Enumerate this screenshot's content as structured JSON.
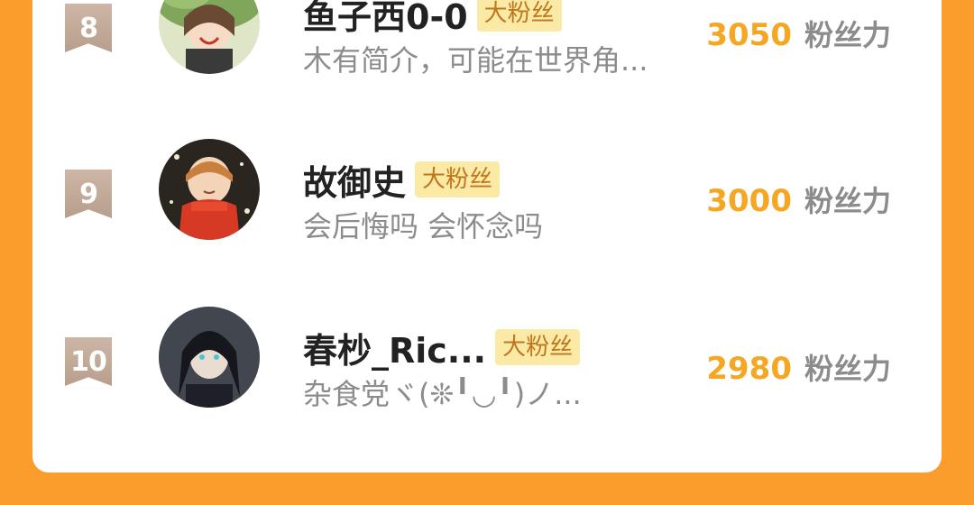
{
  "fans": [
    {
      "rank": "8",
      "name": "鱼子西0-0",
      "badge": "大粉丝",
      "bio": "木有简介，可能在世界角...",
      "score": "3050",
      "score_unit": "粉丝力"
    },
    {
      "rank": "9",
      "name": "故御史",
      "badge": "大粉丝",
      "bio": "会后悔吗 会怀念吗",
      "score": "3000",
      "score_unit": "粉丝力"
    },
    {
      "rank": "10",
      "name": "春杪_Ric...",
      "badge": "大粉丝",
      "bio": "杂食党ヾ(❊╹◡╹)ノ...",
      "score": "2980",
      "score_unit": "粉丝力"
    }
  ],
  "colors": {
    "background": "#fb9d2c",
    "score": "#f5a623",
    "badge_bg": "#fbeaa6",
    "badge_text": "#c0771c"
  }
}
